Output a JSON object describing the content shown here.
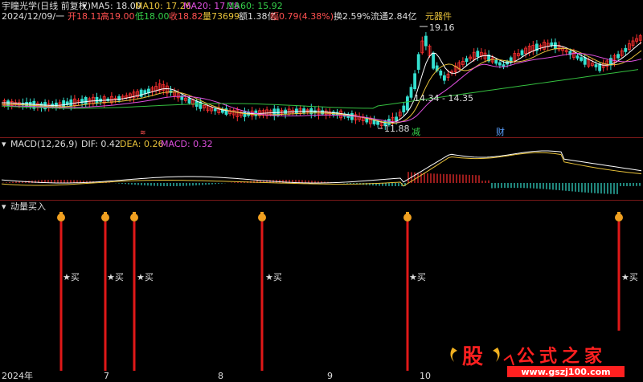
{
  "header": {
    "stock_title": "宇瞳光学(日线 前复权)",
    "ma5": "MA5: 18.00",
    "ma10": "MA10: 17.26",
    "ma20": "MA20: 17.18",
    "ma60": "MA60: 15.92",
    "date": "2024/12/09/一",
    "open": "开18.11",
    "high": "高19.00",
    "low": "低18.00",
    "close": "收18.82",
    "volume": "量73699",
    "amount": "额1.38亿",
    "change": "幅0.79(4.38%)",
    "turnover": "换2.59%",
    "float": "流通2.84亿",
    "sector": "元器件"
  },
  "price_panel": {
    "high_label": "19.16",
    "low_label": "11.88",
    "range_label": "14.34 - 14.35",
    "event_mark_1": "减",
    "event_mark_2": "财",
    "event_mark_3": "≋"
  },
  "macd_panel": {
    "title": "MACD(12,26,9)",
    "dif": "DIF: 0.42",
    "dea": "DEA: 0.26",
    "macd": "MACD: 0.32"
  },
  "signal_panel": {
    "title": "动量买入",
    "signals": [
      {
        "label": "★买"
      },
      {
        "label": "★买"
      },
      {
        "label": "★买"
      },
      {
        "label": "★买"
      },
      {
        "label": "★买"
      },
      {
        "label": "★买"
      }
    ]
  },
  "x_axis": {
    "labels": [
      "2024年",
      "7",
      "8",
      "9",
      "10"
    ]
  },
  "watermark": {
    "glyph": "股",
    "brand": "公式之家",
    "url": "www.gszj100.com"
  },
  "colors": {
    "background": "#000000",
    "rise": "#ff3030",
    "fall": "#35e0d0",
    "ma_white": "#ffffff",
    "ma_yellow": "#e8c23a",
    "ma_magenta": "#e050e0",
    "ma_green": "#35c040",
    "separator": "#7a1818"
  }
}
